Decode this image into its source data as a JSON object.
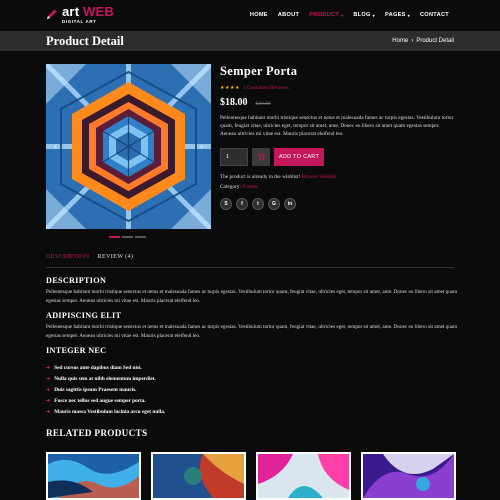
{
  "brand": {
    "name_a": "art",
    "name_b": "WEB",
    "tagline": "DIGITAL ART"
  },
  "nav": [
    {
      "label": "HOME",
      "dropdown": false,
      "active": false
    },
    {
      "label": "ABOUT",
      "dropdown": false,
      "active": false
    },
    {
      "label": "PRODUCT",
      "dropdown": true,
      "active": true
    },
    {
      "label": "BLOG",
      "dropdown": true,
      "active": false
    },
    {
      "label": "PAGES",
      "dropdown": true,
      "active": false
    },
    {
      "label": "CONTACT",
      "dropdown": false,
      "active": false
    }
  ],
  "page": {
    "title": "Product Detail",
    "breadcrumb_home": "Home",
    "breadcrumb_sep": "›",
    "breadcrumb_current": "Product Detail"
  },
  "product": {
    "title": "Semper Porta",
    "stars": "★★★★",
    "reviews_label": "3 Customer Reviews",
    "price_new": "$18.00",
    "price_old": "$20.00",
    "description": "Pellentesque habitant morbi tristique senectus et netus et malesuada fames ac turpis egestas. Vestibulum tortor quam, feugiat vitae, ultricies eget, tempor sit amet, ante. Donec eu libero sit amet quam egestas semper. Aenean ultricies mi vitae est. Mauris placerat eleifend leo.",
    "quantity": "1",
    "add_to_cart": "ADD TO CART",
    "wishlist_text": "The product is already in the wishlist!",
    "wishlist_link": "Browse Wishlist",
    "category_label": "Category:",
    "category_value": "Posters",
    "social": [
      "skype-icon",
      "facebook-icon",
      "twitter-icon",
      "google-plus-icon",
      "linkedin-icon"
    ]
  },
  "gallery": {
    "prev": "‹",
    "next": "›",
    "slide_count": 3,
    "active_slide": 1
  },
  "tabs": [
    {
      "label": "DESCRIPTION",
      "active": true
    },
    {
      "label": "REVIEW (4)",
      "active": false
    }
  ],
  "content": {
    "h1": "DESCRIPTION",
    "p1": "Pellentesque habitant morbi tristique senectus et netus et malesuada fames ac turpis egestas. Vestibulum tortor quam, feugiat vitae, ultricies eget, tempor sit amet, ante. Donec eu libero sit amet quam egestas semper. Aenean ultricies mi vitae est. Mauris placerat eleifend leo.",
    "h2": "ADIPISCING ELIT",
    "p2": "Pellentesque habitant morbi tristique senectus et netus et malesuada fames ac turpis egestas. Vestibulum tortor quam, feugiat vitae, ultricies eget, tempor sit amet, ante. Donec eu libero sit amet quam egestas semper. Aenean ultricies mi vitae est. Mauris placerat eleifend leo.",
    "h3": "INTEGER NEC",
    "list": [
      "Sed cursus ante dapibus diam Sed nisi.",
      "Nulla quis sem at nibh elementum imperdiet.",
      "Duis sagittis ipsum Praesent mauris.",
      "Fusce nec tellus sed augue semper porta.",
      "Mauris massa Vestibulum lacinia arcu eget nulla."
    ]
  },
  "related": {
    "title": "RELATED PRODUCTS"
  },
  "colors": {
    "accent": "#c2185b",
    "star": "#f4b400",
    "bg": "#0b0b0b",
    "bar": "#2c2c2c"
  }
}
